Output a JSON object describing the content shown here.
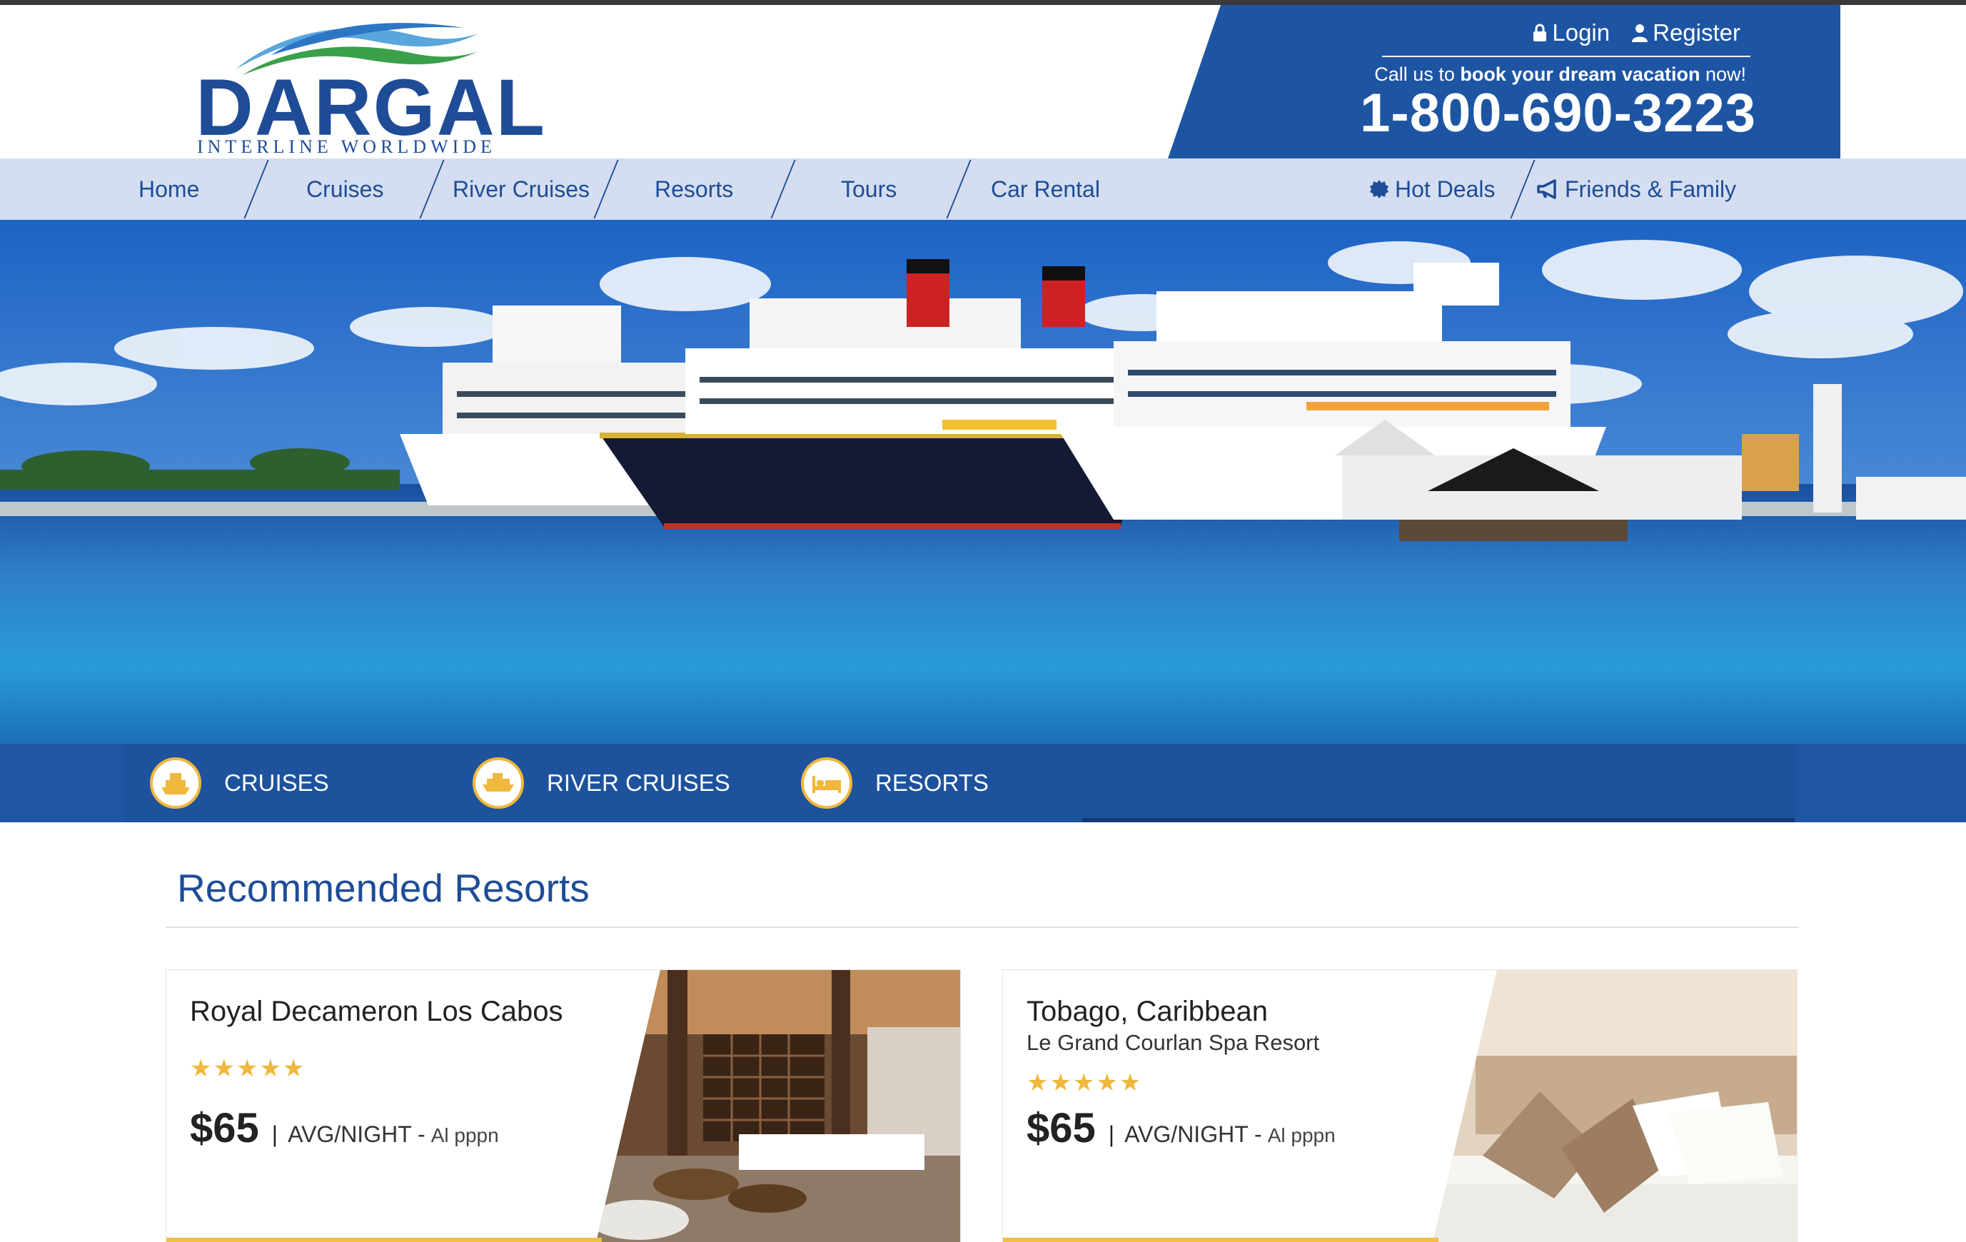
{
  "header": {
    "logo_text": "DARGAL",
    "logo_subtitle": "INTERLINE WORLDWIDE",
    "login_label": "Login",
    "register_label": "Register",
    "call_prefix": "Call us to ",
    "call_bold": "book your dream vacation",
    "call_suffix": " now!",
    "phone": "1-800-690-3223"
  },
  "nav": {
    "items": [
      {
        "label": "Home"
      },
      {
        "label": "Cruises"
      },
      {
        "label": "River Cruises"
      },
      {
        "label": "Resorts"
      },
      {
        "label": "Tours"
      },
      {
        "label": "Car Rental"
      }
    ],
    "hot_deals": "Hot Deals",
    "friends_family": "Friends & Family"
  },
  "categories": [
    {
      "label": "CRUISES",
      "icon": "cruise-ship-icon"
    },
    {
      "label": "RIVER CRUISES",
      "icon": "river-boat-icon"
    },
    {
      "label": "RESORTS",
      "icon": "bed-icon"
    }
  ],
  "recommended": {
    "title": "Recommended Resorts",
    "cards": [
      {
        "title": "Royal Decameron Los Cabos",
        "subtitle": "",
        "stars": "★★★★★",
        "price": "$65",
        "unit": "AVG/NIGHT -",
        "note": "Al pppn"
      },
      {
        "title": "Tobago, Caribbean",
        "subtitle": "Le Grand Courlan Spa Resort",
        "stars": "★★★★★",
        "price": "$65",
        "unit": "AVG/NIGHT -",
        "note": "Al pppn"
      }
    ]
  },
  "colors": {
    "brand_blue": "#1e55a3",
    "nav_bg": "#d4def0",
    "accent_gold": "#f0b83c"
  }
}
